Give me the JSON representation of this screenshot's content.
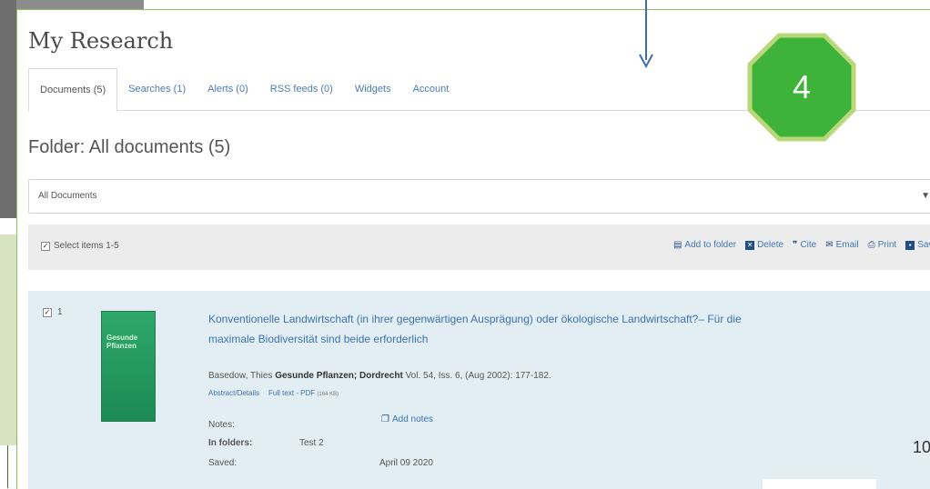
{
  "page_title": "My Research",
  "tabs": [
    {
      "label": "Documents (5)",
      "active": true
    },
    {
      "label": "Searches (1)",
      "active": false
    },
    {
      "label": "Alerts (0)",
      "active": false
    },
    {
      "label": "RSS feeds (0)",
      "active": false
    },
    {
      "label": "Widgets",
      "active": false
    },
    {
      "label": "Account",
      "active": false
    }
  ],
  "folder_title": "Folder: All documents (5)",
  "folder_select": {
    "value": "All Documents"
  },
  "toolbar": {
    "select_all": "Select items 1-5",
    "actions": {
      "add_to_folder": "Add to folder",
      "delete": "Delete",
      "cite": "Cite",
      "email": "Email",
      "print": "Print",
      "save": "Save"
    }
  },
  "result": {
    "number": "1",
    "cover_text": "Gesunde Pflanzen",
    "title": "Konventionelle Landwirtschaft (in ihrer gegenwärtigen Ausprägung) oder ökologische Landwirtschaft?– Für die maximale Biodiversität sind beide erforderlich",
    "author": "Basedow, Thies",
    "source": "Gesunde Pflanzen; Dordrecht",
    "citation": "Vol. 54, Iss. 6, (Aug 2002): 177-182.",
    "abstract_link": "Abstract/Details",
    "fulltext_link": "Full text - PDF",
    "fulltext_size": "(164 KB)",
    "notes_label": "Notes:",
    "add_notes": "Add notes",
    "folders_label": "In folders:",
    "folders_value": "Test 2",
    "saved_label": "Saved:",
    "saved_value": "April 09 2020"
  },
  "badge_number": "4",
  "page_number": "10",
  "colors": {
    "link": "#3a73b0",
    "badge_fill": "#3db339",
    "badge_border": "#b8d87a",
    "arrow": "#3b6db4"
  }
}
